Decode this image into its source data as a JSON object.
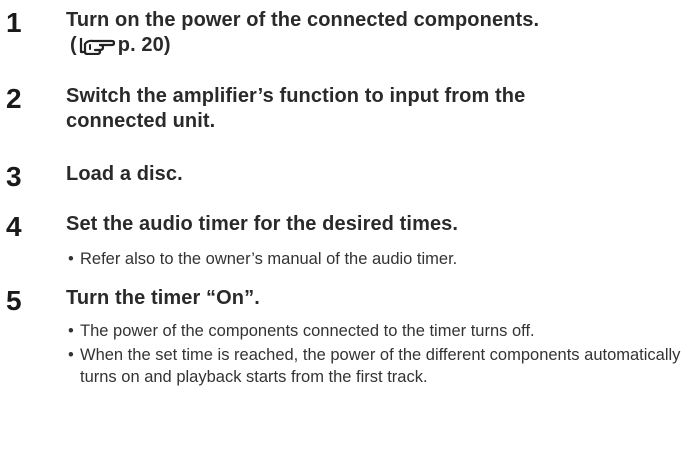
{
  "steps": [
    {
      "number": "1",
      "title": "Turn on the power of the connected components.",
      "ref_open": "(",
      "ref_icon": "pointing-hand-icon",
      "ref_text": "p. 20)"
    },
    {
      "number": "2",
      "title": "Switch the amplifier’s function to input from the connected unit."
    },
    {
      "number": "3",
      "title": "Load a disc."
    },
    {
      "number": "4",
      "title": "Set the audio timer for the desired times.",
      "bullets": [
        "Refer also to the owner’s manual of the audio timer."
      ]
    },
    {
      "number": "5",
      "title": "Turn the timer “On”.",
      "bullets": [
        "The power of the components connected to the timer turns off.",
        "When the set time is reached, the power of the different components automatically turns on and playback starts from the first track."
      ]
    }
  ],
  "bullet_char": "•"
}
